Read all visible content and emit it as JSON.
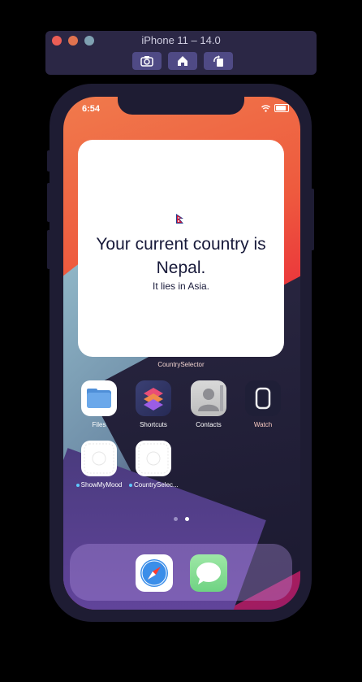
{
  "simulator": {
    "title": "iPhone 11 – 14.0",
    "buttons": [
      "screenshot-icon",
      "home-icon",
      "rotate-icon"
    ]
  },
  "status_bar": {
    "time": "6:54"
  },
  "widget": {
    "flag": "nepal-flag-icon",
    "title": "Your current country is Nepal.",
    "subtitle": "It lies in Asia.",
    "label": "CountrySelector"
  },
  "apps": [
    {
      "label": "Files"
    },
    {
      "label": "Shortcuts"
    },
    {
      "label": "Contacts"
    },
    {
      "label": "Watch"
    },
    {
      "label": "ShowMyMood"
    },
    {
      "label": "CountrySelec..."
    }
  ],
  "page_dots": {
    "count": 2,
    "active_index": 1
  },
  "dock": [
    "safari-icon",
    "messages-icon"
  ],
  "colors": {
    "accent": "#ee5a3e",
    "widget_text": "#181a3a",
    "phone_body": "#1e1c33"
  }
}
